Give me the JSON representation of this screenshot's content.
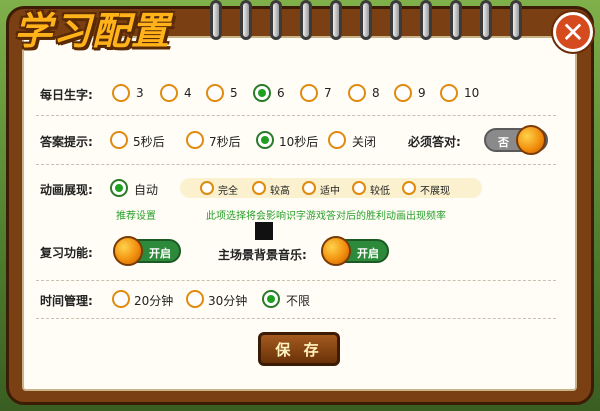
{
  "title": "学习配置",
  "daily_words": {
    "label": "每日生字:",
    "options": [
      "3",
      "4",
      "5",
      "6",
      "7",
      "8",
      "9",
      "10"
    ],
    "selected": "6"
  },
  "answer_hint": {
    "label": "答案提示:",
    "options": [
      "5秒后",
      "7秒后",
      "10秒后",
      "关闭"
    ],
    "selected": "10秒后",
    "must_answer_label": "必须答对:",
    "must_answer_state": "否"
  },
  "animation": {
    "label": "动画展现:",
    "auto_label": "自动",
    "auto_selected": true,
    "recommend": "推荐设置",
    "levels": [
      "完全",
      "较高",
      "适中",
      "较低",
      "不展现"
    ],
    "note": "此项选择将会影响识字游戏答对后的胜利动画出现频率"
  },
  "review": {
    "label": "复习功能:",
    "state": "开启"
  },
  "music": {
    "label": "主场景背景音乐:",
    "state": "开启"
  },
  "time": {
    "label": "时间管理:",
    "options": [
      "20分钟",
      "30分钟",
      "不限"
    ],
    "selected": "不限"
  },
  "save_label": "保 存",
  "close_label": "✕"
}
